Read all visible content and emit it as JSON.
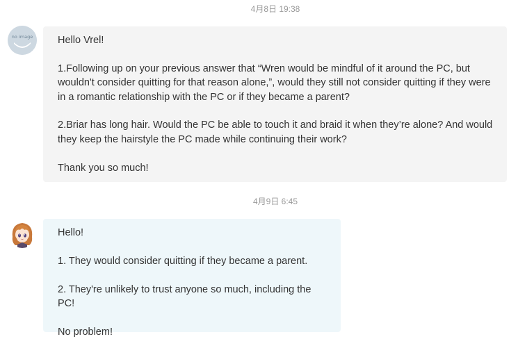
{
  "messages": [
    {
      "timestamp": "4月8日 19:38",
      "avatar_icon": "default-image-avatar-icon",
      "avatar_text": "no image",
      "paragraphs": [
        "Hello Vrel!",
        "1.Following up on your previous answer that “Wren would be mindful of it around the PC, but wouldn't consider quitting for that reason alone,”, would they still not consider quitting if they were in a romantic relationship with the PC or if they became a parent?",
        "2.Briar has long hair. Would the PC be able to touch it and braid it when they’re alone? And would they keep the hairstyle the PC made while continuing their work?",
        "Thank you so much!"
      ]
    },
    {
      "timestamp": "4月9日 6:45",
      "avatar_icon": "anime-girl-avatar-icon",
      "paragraphs": [
        "Hello!",
        "1. They would consider quitting if they became a parent.",
        "2. They're unlikely to trust anyone so much, including the PC!",
        "No problem!"
      ]
    }
  ],
  "colors": {
    "incoming_bubble": "#f4f4f4",
    "reply_bubble": "#eef7fa",
    "timestamp_text": "#9a9a9a",
    "message_text": "#333333"
  }
}
